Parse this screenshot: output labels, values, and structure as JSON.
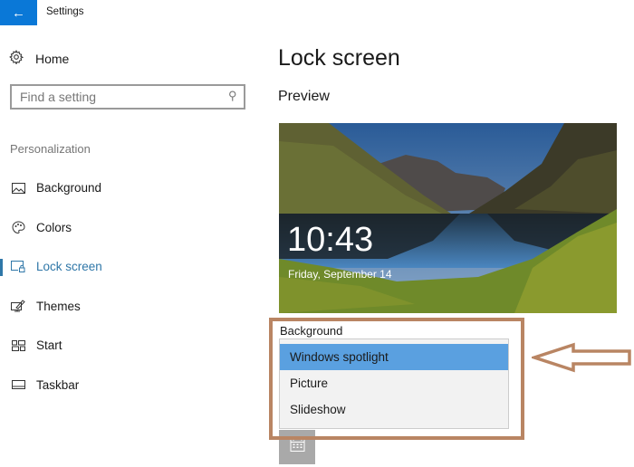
{
  "window": {
    "title": "Settings",
    "back_icon": "back-arrow-icon",
    "accent_color": "#0a78d7"
  },
  "sidebar": {
    "home": {
      "label": "Home",
      "icon": "gear-icon"
    },
    "search": {
      "placeholder": "Find a setting",
      "value": "",
      "icon": "search-icon"
    },
    "section_title": "Personalization",
    "items": [
      {
        "label": "Background",
        "icon": "picture-icon",
        "active": false
      },
      {
        "label": "Colors",
        "icon": "palette-icon",
        "active": false
      },
      {
        "label": "Lock screen",
        "icon": "lock-screen-icon",
        "active": true
      },
      {
        "label": "Themes",
        "icon": "themes-icon",
        "active": false
      },
      {
        "label": "Start",
        "icon": "start-icon",
        "active": false
      },
      {
        "label": "Taskbar",
        "icon": "taskbar-icon",
        "active": false
      }
    ],
    "active_color": "#2f77a8"
  },
  "main": {
    "title": "Lock screen",
    "preview_heading": "Preview",
    "preview": {
      "time": "10:43",
      "date": "Friday, September 14"
    },
    "background": {
      "label": "Background",
      "options": [
        "Windows spotlight",
        "Picture",
        "Slideshow"
      ],
      "selected": "Windows spotlight",
      "selected_color": "#5aa0e0"
    },
    "calendar_icon": "calendar-icon"
  },
  "annotation": {
    "box_color": "#b98563",
    "arrow_color": "#b98563"
  }
}
